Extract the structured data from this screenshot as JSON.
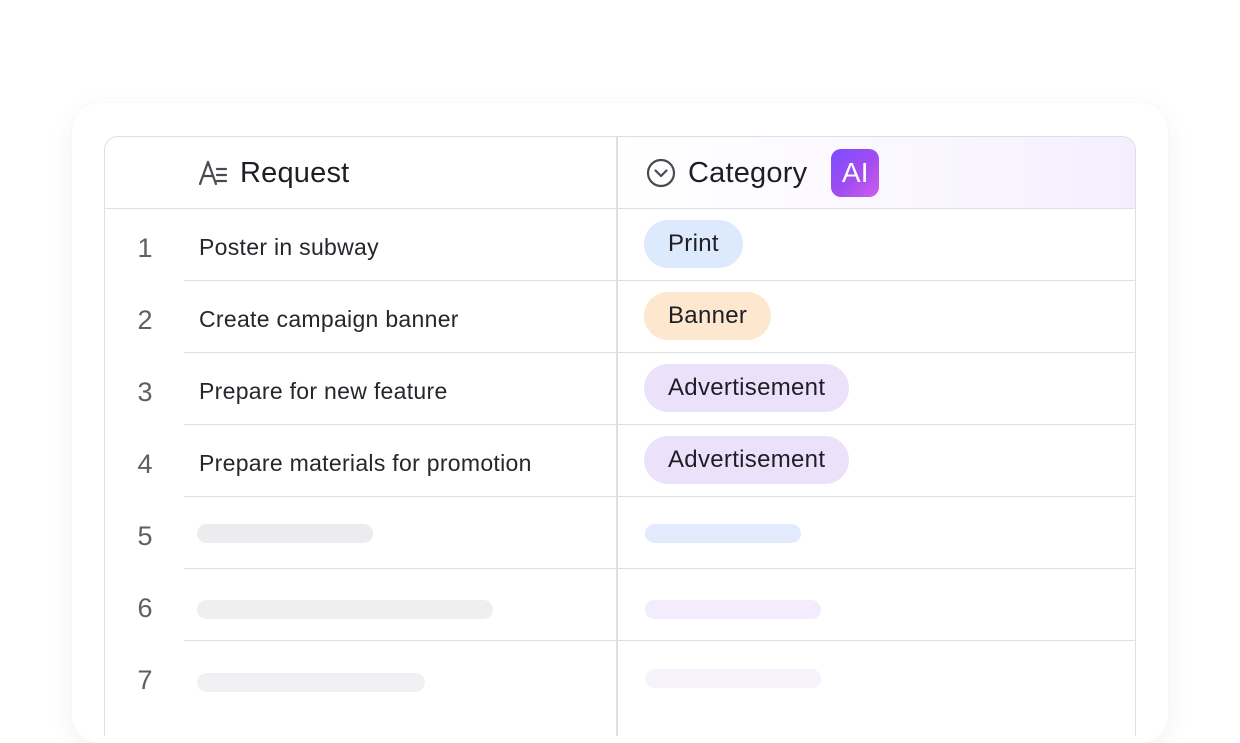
{
  "columns": {
    "request": {
      "label": "Request",
      "icon": "text-field-icon"
    },
    "category": {
      "label": "Category",
      "icon": "chevron-circle-icon",
      "ai_badge": "AI"
    }
  },
  "rows": [
    {
      "num": "1",
      "request": "Poster in subway",
      "category": "Print"
    },
    {
      "num": "2",
      "request": "Create campaign banner",
      "category": "Banner"
    },
    {
      "num": "3",
      "request": "Prepare for new feature",
      "category": "Advertisement"
    },
    {
      "num": "4",
      "request": "Prepare materials for promotion",
      "category": "Advertisement"
    },
    {
      "num": "5"
    },
    {
      "num": "6"
    },
    {
      "num": "7"
    }
  ],
  "colors": {
    "print_pill": "#dde9fd",
    "banner_pill": "#fde8cf",
    "advertisement_pill": "#ece1fb",
    "skeleton_gray": "#ececee",
    "skeleton_blue": "#e2ebfd",
    "skeleton_purple": "#f2ecfc",
    "ai_badge": "#9b4df2"
  }
}
